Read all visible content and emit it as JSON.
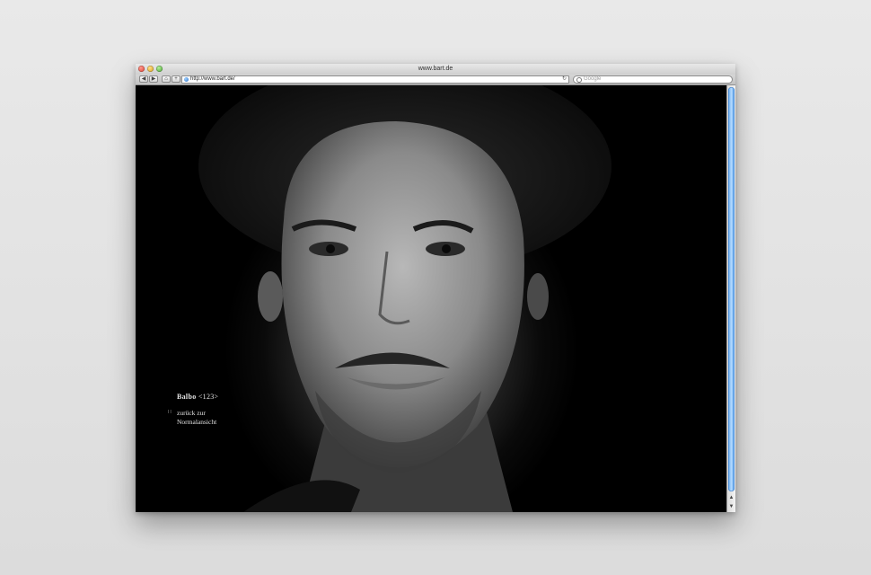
{
  "window": {
    "title": "www.bart.de"
  },
  "toolbar": {
    "back_glyph": "◀",
    "forward_glyph": "▶",
    "home_glyph": "⌂",
    "add_bookmark_glyph": "+",
    "url": "http://www.bart.de/",
    "reload_glyph": "↻",
    "search_placeholder": "Google"
  },
  "page": {
    "title_name": "Balbo",
    "title_range": "<123>",
    "back_icon_glyph": "∷",
    "back_line1": "zurück zur",
    "back_line2": "Normalansicht"
  },
  "scrollbar": {
    "up_glyph": "▲",
    "down_glyph": "▼"
  },
  "colors": {
    "scroll_thumb": "#5aa4ee",
    "page_background": "#000000",
    "caption_text": "#e4e4e4"
  }
}
